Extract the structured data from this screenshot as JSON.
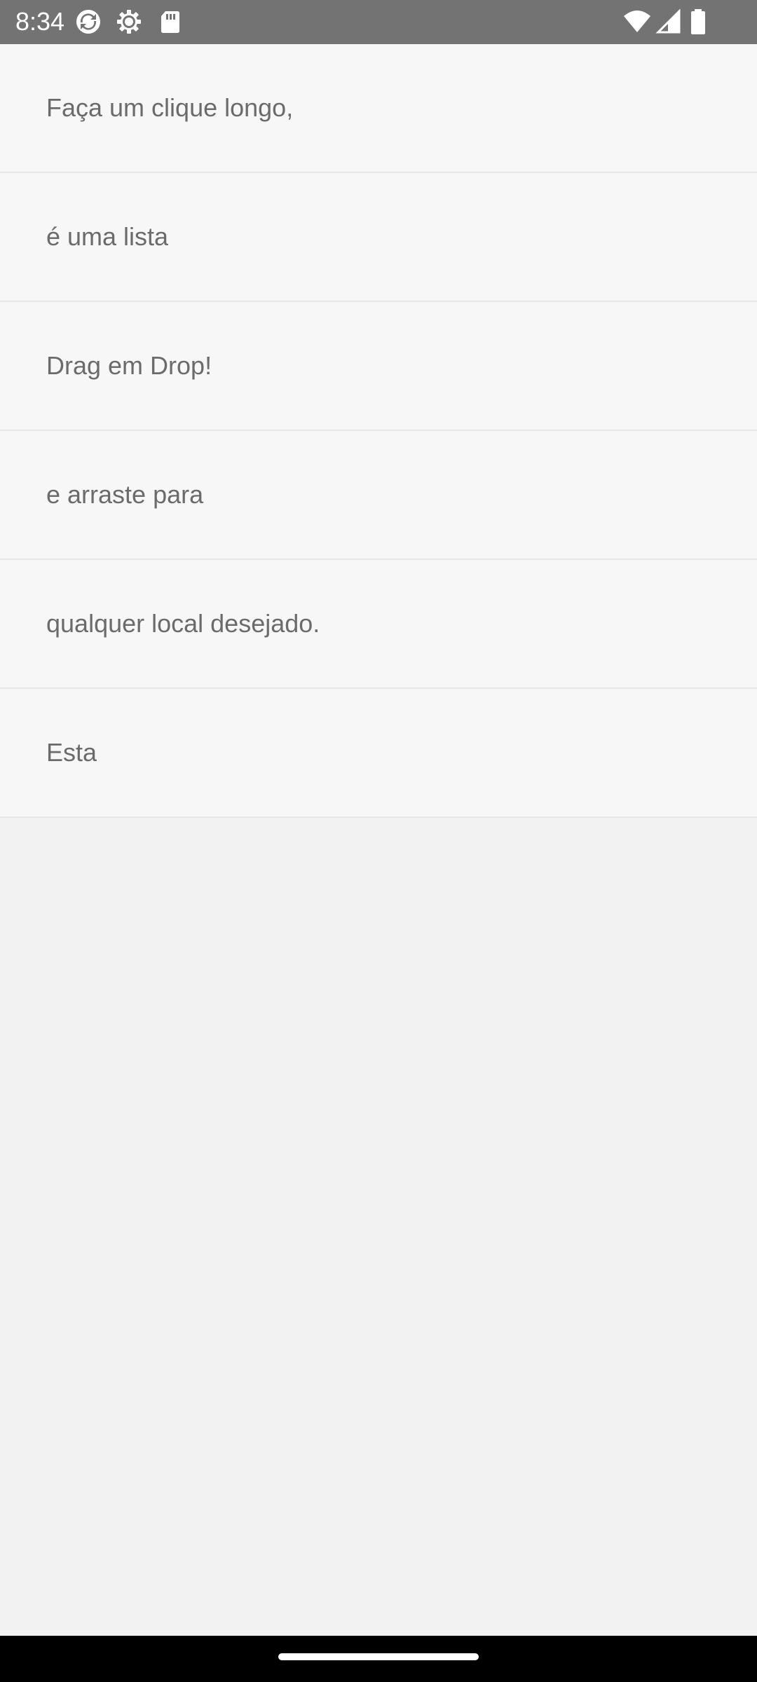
{
  "status_bar": {
    "time": "8:34",
    "icons_left": [
      "sync-icon",
      "settings-icon",
      "sd-card-icon"
    ],
    "icons_right": [
      "wifi-icon",
      "signal-icon",
      "battery-icon"
    ],
    "background": "#737373"
  },
  "list": {
    "items": [
      {
        "label": "Faça um clique longo,"
      },
      {
        "label": "é uma lista"
      },
      {
        "label": "Drag em Drop!"
      },
      {
        "label": "e arraste para"
      },
      {
        "label": "qualquer local desejado."
      },
      {
        "label": "Esta"
      }
    ]
  },
  "nav_bar": {
    "background": "#000000",
    "indicator_color": "#ffffff"
  }
}
